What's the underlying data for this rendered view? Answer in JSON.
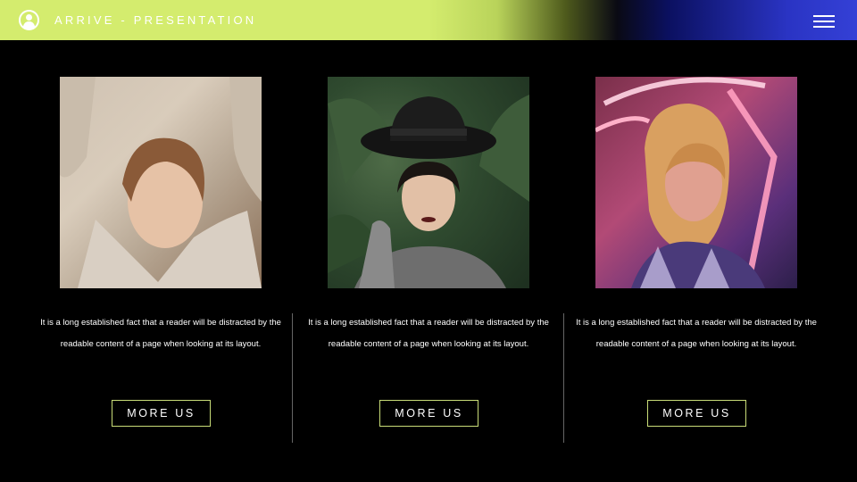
{
  "header": {
    "brand": "ARRIVE - PRESENTATION",
    "logo_icon": "user-circle-icon",
    "menu_icon": "hamburger-menu-icon"
  },
  "colors": {
    "header_left": "#d4ec6e",
    "header_right": "#3440d6",
    "background": "#000000",
    "button_border": "#c9dd78",
    "divider": "#666666"
  },
  "cards": [
    {
      "photo": "woman-in-beige-sweater-portrait",
      "text": "It is a long established fact that a reader will be distracted by the readable content of a page when looking at its layout.",
      "button": "MORE US"
    },
    {
      "photo": "woman-in-black-hat-among-leaves-portrait",
      "text": "It is a long established fact that a reader will be distracted by the readable content of a page when looking at its layout.",
      "button": "MORE US"
    },
    {
      "photo": "woman-with-neon-lights-portrait",
      "text": "It is a long established fact that a reader will be distracted by the readable content of a page when looking at its layout.",
      "button": "MORE US"
    }
  ]
}
